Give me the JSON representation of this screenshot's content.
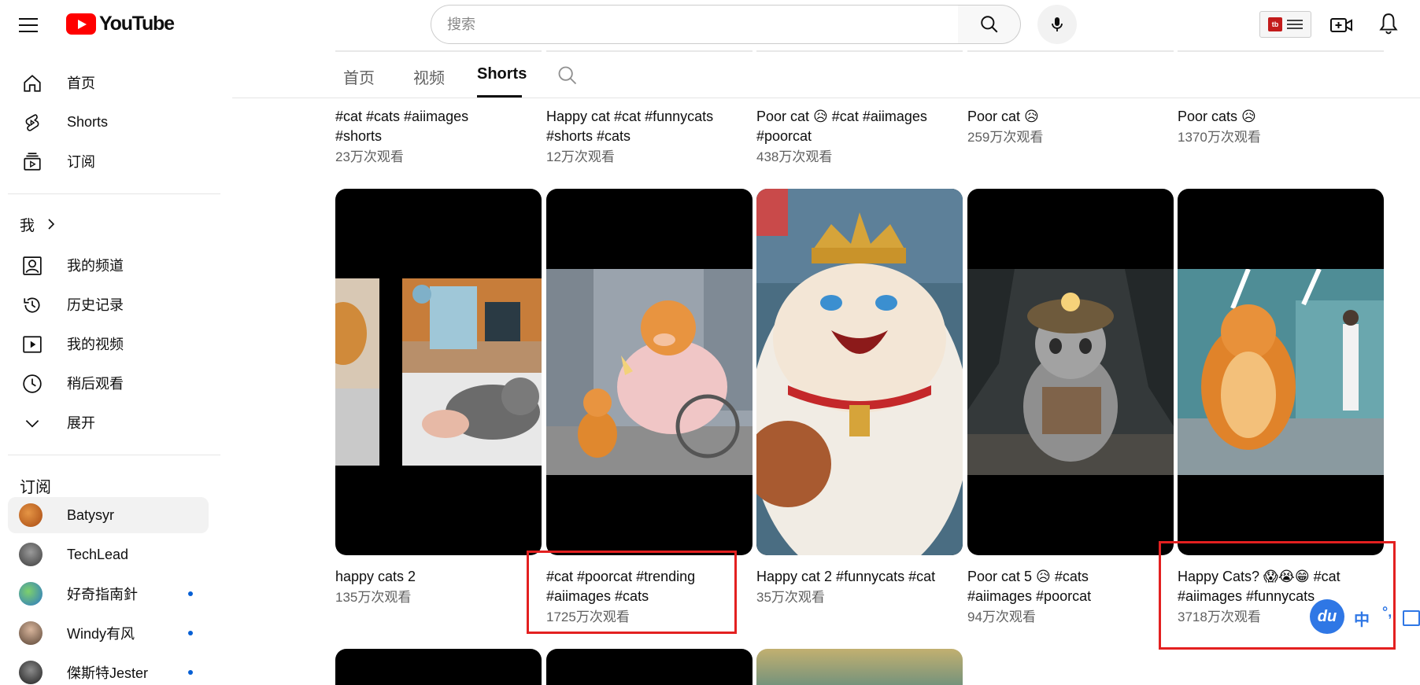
{
  "header": {
    "logo_text": "YouTube",
    "search_placeholder": "搜索",
    "ext_badge_text": "tb"
  },
  "sidebar": {
    "main": [
      {
        "label": "首页",
        "icon": "home-icon"
      },
      {
        "label": "Shorts",
        "icon": "shorts-icon"
      },
      {
        "label": "订阅",
        "icon": "subscriptions-icon"
      }
    ],
    "me_title": "我",
    "me": [
      {
        "label": "我的频道",
        "icon": "your-channel-icon"
      },
      {
        "label": "历史记录",
        "icon": "history-icon"
      },
      {
        "label": "我的视频",
        "icon": "your-videos-icon"
      },
      {
        "label": "稍后观看",
        "icon": "watch-later-icon"
      },
      {
        "label": "展开",
        "icon": "chevron-down-icon"
      }
    ],
    "subs_title": "订阅",
    "subscriptions": [
      {
        "label": "Batysyr",
        "color": "#c9641f",
        "new": false,
        "active": true
      },
      {
        "label": "TechLead",
        "color": "#6b6b6b",
        "new": false,
        "active": false
      },
      {
        "label": "好奇指南針",
        "color": "#3a8fd8",
        "new": true,
        "active": false
      },
      {
        "label": "Windy有风",
        "color": "#8a6f5d",
        "new": true,
        "active": false
      },
      {
        "label": "傑斯特Jester",
        "color": "#3b3b3b",
        "new": true,
        "active": false
      }
    ]
  },
  "tabs": [
    {
      "label": "首页",
      "active": false
    },
    {
      "label": "视频",
      "active": false
    },
    {
      "label": "Shorts",
      "active": true
    }
  ],
  "shorts_row_top": [
    {
      "title": "#cat #cats #aiimages\n#shorts",
      "views": "23万次观看"
    },
    {
      "title": "Happy cat #cat #funnycats\n#shorts #cats",
      "views": "12万次观看"
    },
    {
      "title": "Poor cat 😥 #cat #aiimages\n#poorcat",
      "views": "438万次观看"
    },
    {
      "title": "Poor cat 😥",
      "views": "259万次观看"
    },
    {
      "title": "Poor cats 😥",
      "views": "1370万次观看"
    }
  ],
  "shorts_row_mid": [
    {
      "title": "happy cats 2",
      "views": "135万次观看",
      "thumb": "hospital-cat"
    },
    {
      "title": "#cat #poorcat #trending\n#aiimages #cats",
      "views": "1725万次观看",
      "thumb": "fat-cat-wheelchair"
    },
    {
      "title": "Happy cat 2 #funnycats #cat",
      "views": "35万次观看",
      "thumb": "king-cat"
    },
    {
      "title": "Poor cat 5 😥 #cats\n#aiimages #poorcat",
      "views": "94万次观看",
      "thumb": "miner-cat"
    },
    {
      "title": "Happy Cats? 😱😭😁 #cat\n#aiimages #funnycats",
      "views": "3718万次观看",
      "thumb": "fat-cat-hallway"
    }
  ],
  "ime": {
    "logo": "du",
    "lang": "中",
    "punct": "°,"
  },
  "colors": {
    "highlight": "#e32020",
    "brand_red": "#ff0000",
    "link_blue": "#065fd4"
  }
}
